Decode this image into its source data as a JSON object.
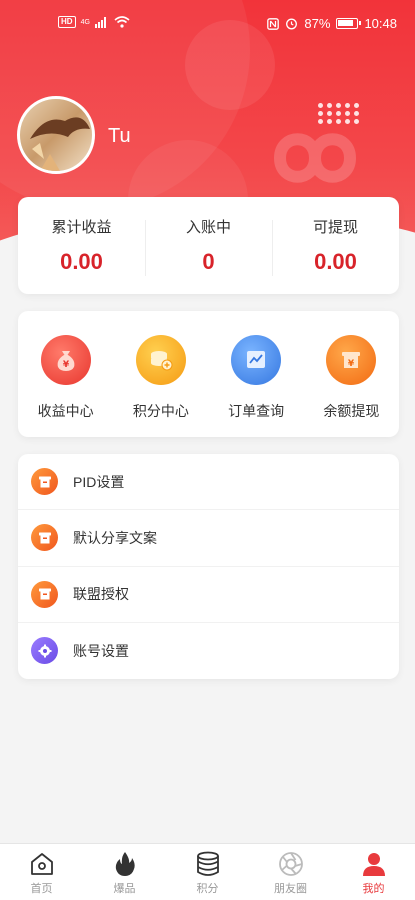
{
  "status_bar": {
    "carrier_badge": "HD",
    "network": "4G",
    "battery": "87%",
    "time": "10:48"
  },
  "profile": {
    "username": "Tu"
  },
  "stats": [
    {
      "label": "累计收益",
      "value": "0.00"
    },
    {
      "label": "入账中",
      "value": "0"
    },
    {
      "label": "可提现",
      "value": "0.00"
    }
  ],
  "quick_actions": [
    {
      "label": "收益中心",
      "icon": "money-bag-icon",
      "color": "#f0453f"
    },
    {
      "label": "积分中心",
      "icon": "coins-icon",
      "color": "#f7a81a"
    },
    {
      "label": "订单查询",
      "icon": "chart-icon",
      "color": "#3f86ea"
    },
    {
      "label": "余额提现",
      "icon": "withdraw-icon",
      "color": "#f57a1c"
    }
  ],
  "menu": [
    {
      "label": "PID设置",
      "icon": "box-icon"
    },
    {
      "label": "默认分享文案",
      "icon": "box-icon"
    },
    {
      "label": "联盟授权",
      "icon": "box-icon"
    },
    {
      "label": "账号设置",
      "icon": "gear-icon"
    }
  ],
  "tabs": [
    {
      "label": "首页",
      "icon": "home-icon",
      "active": false
    },
    {
      "label": "爆品",
      "icon": "flame-icon",
      "active": false
    },
    {
      "label": "积分",
      "icon": "database-icon",
      "active": false
    },
    {
      "label": "朋友圈",
      "icon": "aperture-icon",
      "active": false
    },
    {
      "label": "我的",
      "icon": "user-icon",
      "active": true
    }
  ],
  "colors": {
    "primary_red": "#e83a3d",
    "value_red": "#d8232a",
    "menu_icon_orange": "#f0611e",
    "settings_purple": "#7b5cf0"
  }
}
